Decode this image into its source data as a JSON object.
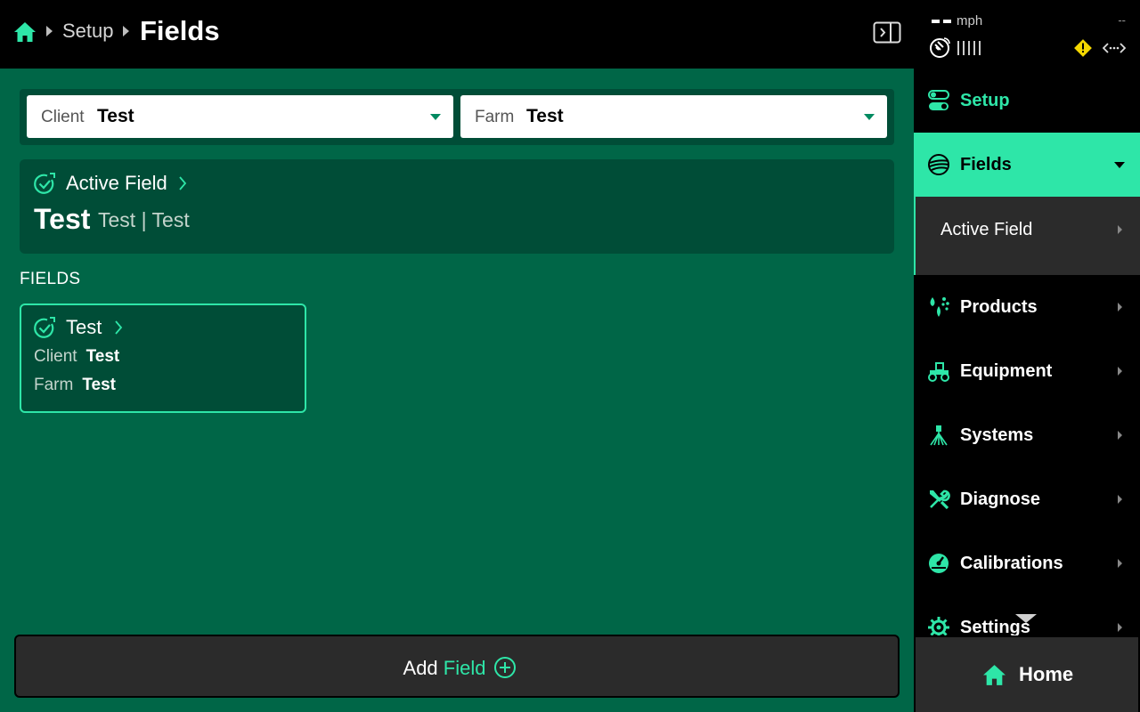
{
  "header": {
    "breadcrumb_setup": "Setup",
    "title": "Fields"
  },
  "filters": {
    "client_label": "Client",
    "client_value": "Test",
    "farm_label": "Farm",
    "farm_value": "Test"
  },
  "active_field": {
    "title": "Active Field",
    "name": "Test",
    "subtitle": "Test | Test"
  },
  "fields_section": {
    "label": "FIELDS",
    "items": [
      {
        "name": "Test",
        "client_label": "Client",
        "client": "Test",
        "farm_label": "Farm",
        "farm": "Test"
      }
    ]
  },
  "add_button": {
    "prefix": "Add",
    "accent": "Field"
  },
  "status": {
    "speed_unit": "mph",
    "right_readout": "--"
  },
  "sidebar": {
    "setup": "Setup",
    "fields": "Fields",
    "active_field": "Active Field",
    "items": [
      {
        "label": "Products",
        "icon": "droplets-icon"
      },
      {
        "label": "Equipment",
        "icon": "tractor-icon"
      },
      {
        "label": "Systems",
        "icon": "sprayer-icon"
      },
      {
        "label": "Diagnose",
        "icon": "wrench-screwdriver-icon"
      },
      {
        "label": "Calibrations",
        "icon": "gauge-icon"
      },
      {
        "label": "Settings",
        "icon": "gear-icon"
      }
    ],
    "home": "Home"
  },
  "colors": {
    "accent": "#2ee6a8",
    "main_bg": "#006647",
    "card_bg": "#004d37",
    "warning": "#f5d800"
  }
}
